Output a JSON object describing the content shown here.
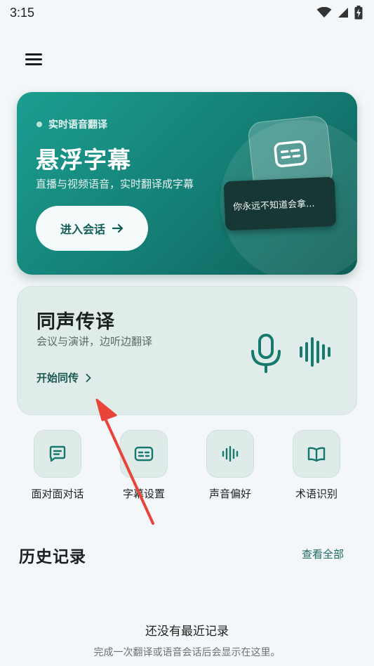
{
  "status": {
    "time": "3:15",
    "icons": [
      "wifi-icon",
      "signal-icon",
      "battery-charging-icon"
    ]
  },
  "header": {
    "menu_icon": "menu-icon"
  },
  "hero": {
    "kicker": "实时语音翻译",
    "title": "悬浮字幕",
    "subtitle": "直播与视频语音，实时翻译成字幕",
    "cta_label": "进入会话",
    "cta_icon": "arrow-right-icon",
    "caption_preview": "你永远不知道会拿...",
    "accent": "#147d74"
  },
  "simul": {
    "title": "同声传译",
    "subtitle": "会议与演讲，边听边翻译",
    "link_label": "开始同传",
    "link_icon": "chevron-right-icon"
  },
  "quick_actions": [
    {
      "label": "面对面对话",
      "icon": "chat-bubble-icon"
    },
    {
      "label": "字幕设置",
      "icon": "subtitles-icon"
    },
    {
      "label": "声音偏好",
      "icon": "sound-wave-icon"
    },
    {
      "label": "术语识别",
      "icon": "book-icon"
    }
  ],
  "history": {
    "title": "历史记录",
    "view_all": "查看全部",
    "empty_title": "还没有最近记录",
    "empty_desc": "完成一次翻译或语音会话后会显示在这里。"
  },
  "colors": {
    "background": "#f4f7f9",
    "brand": "#147d74",
    "annotation": "#e8443a"
  }
}
